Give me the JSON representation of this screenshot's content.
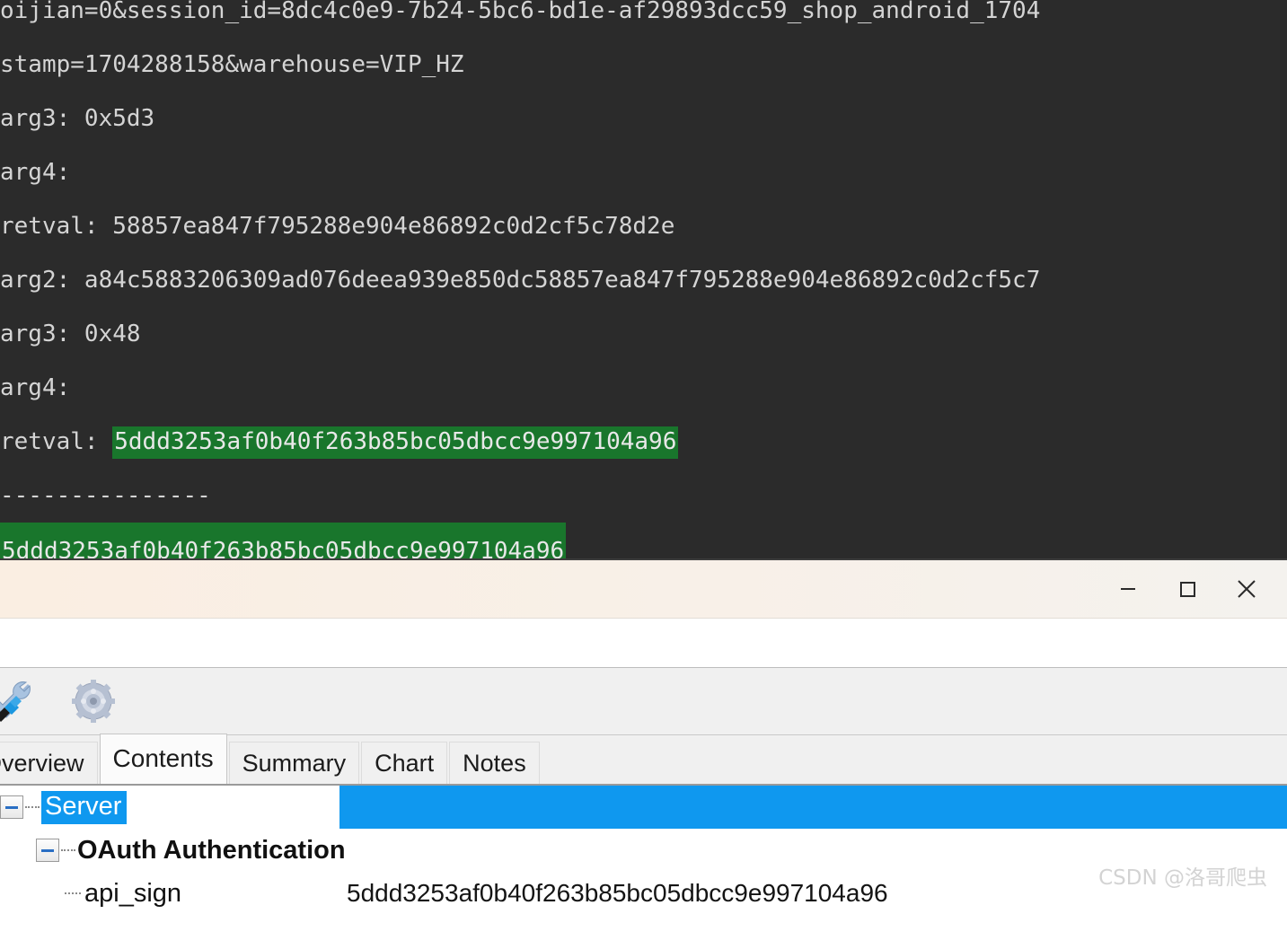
{
  "terminal": {
    "background_color": "#2b2b2b",
    "text_color": "#d4d4d4",
    "highlight_color": "#19762c",
    "lines": [
      {
        "text": "oijian=0&session_id=8dc4c0e9-7b24-5bc6-bd1e-af29893dcc59_shop_android_1704",
        "highlight": "none",
        "clipped_top": true
      },
      {
        "text": "stamp=1704288158&warehouse=VIP_HZ",
        "highlight": "none"
      },
      {
        "text": "arg3: 0x5d3",
        "highlight": "none"
      },
      {
        "text": "arg4:",
        "highlight": "none"
      },
      {
        "text": "retval: 58857ea847f795288e904e86892c0d2cf5c78d2e",
        "highlight": "none"
      },
      {
        "text": "arg2: a84c5883206309ad076deea939e850dc58857ea847f795288e904e86892c0d2cf5c7",
        "highlight": "none"
      },
      {
        "text": "arg3: 0x48",
        "highlight": "none"
      },
      {
        "text": "arg4:",
        "highlight": "none"
      },
      {
        "prefix": "retval: ",
        "highlighted_text": "5ddd3253af0b40f263b85bc05dbcc9e997104a96",
        "highlight": "partial"
      },
      {
        "text": "---------------",
        "highlight": "none"
      },
      {
        "prefix": "",
        "highlighted_text": "5ddd3253af0b40f263b85bc05dbcc9e997104a96",
        "highlight": "partial"
      }
    ]
  },
  "window": {
    "titlebar": {
      "background_color": "#faeee2",
      "minimize_label": "minimize",
      "maximize_label": "maximize",
      "close_label": "close"
    },
    "toolbar": {
      "buttons": [
        {
          "icon": "tools-wrench-icon",
          "label": "Tools"
        },
        {
          "icon": "gear-icon",
          "label": "Settings"
        }
      ]
    },
    "tabs": [
      {
        "label": "Overview",
        "selected": false
      },
      {
        "label": "Contents",
        "selected": true
      },
      {
        "label": "Summary",
        "selected": false
      },
      {
        "label": "Chart",
        "selected": false
      },
      {
        "label": "Notes",
        "selected": false
      }
    ],
    "tree": {
      "selection_color": "#0f98ef",
      "rows": [
        {
          "label": "Server",
          "value": "",
          "depth": 0,
          "expanded": true,
          "selected": true,
          "bold": false
        },
        {
          "label": "OAuth Authentication",
          "value": "",
          "depth": 1,
          "expanded": true,
          "selected": false,
          "bold": true
        },
        {
          "label": "api_sign",
          "value": "5ddd3253af0b40f263b85bc05dbcc9e997104a96",
          "depth": 2,
          "expanded": false,
          "selected": false,
          "bold": false
        }
      ]
    }
  },
  "watermark": {
    "text": "CSDN @洛哥爬虫"
  }
}
